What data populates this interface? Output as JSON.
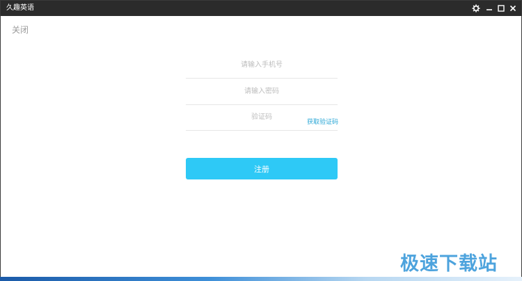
{
  "window": {
    "title": "久趣英语",
    "icons": {
      "settings": "gear-icon",
      "minimize": "minimize-icon",
      "maximize": "maximize-icon",
      "close": "close-icon"
    },
    "titlebar_color": "#2b2b2b"
  },
  "page": {
    "close_label": "关闭"
  },
  "form": {
    "phone_placeholder": "请输入手机号",
    "password_placeholder": "请输入密码",
    "code_placeholder": "验证码",
    "get_code_label": "获取验证码",
    "register_label": "注册"
  },
  "colors": {
    "accent": "#2ec9f6",
    "link": "#2aa7d6"
  },
  "watermark": {
    "text": "极速下载站"
  }
}
